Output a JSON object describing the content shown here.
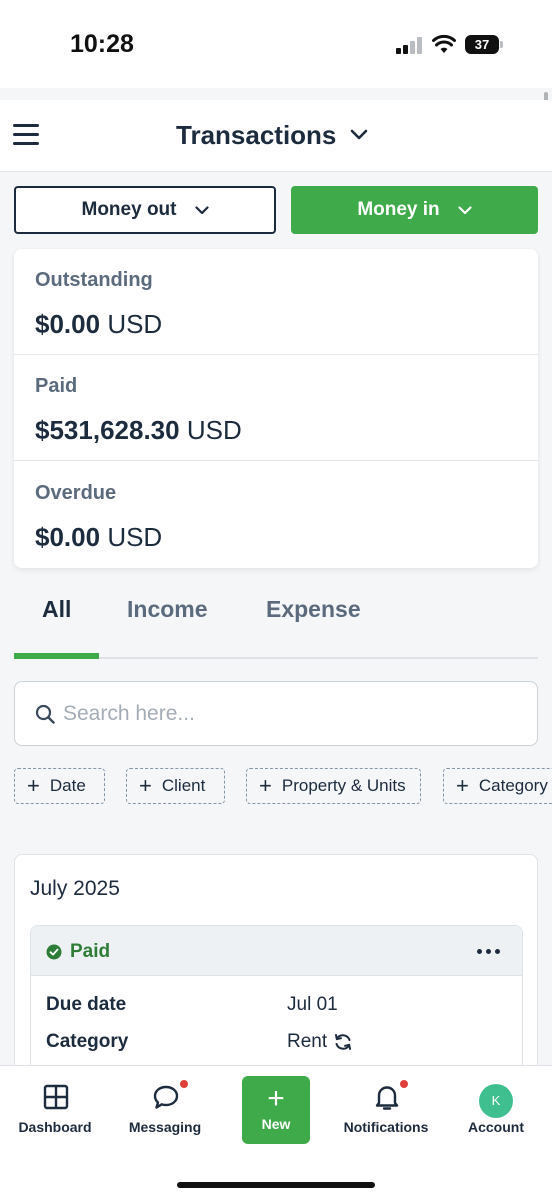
{
  "status_bar": {
    "time": "10:28",
    "battery": "37"
  },
  "header": {
    "title": "Transactions"
  },
  "filters": {
    "money_out": "Money out",
    "money_in": "Money in"
  },
  "summary": [
    {
      "label": "Outstanding",
      "amount": "$0.00",
      "currency": "USD"
    },
    {
      "label": "Paid",
      "amount": "$531,628.30",
      "currency": "USD"
    },
    {
      "label": "Overdue",
      "amount": "$0.00",
      "currency": "USD"
    }
  ],
  "tabs": [
    {
      "label": "All",
      "active": true
    },
    {
      "label": "Income",
      "active": false
    },
    {
      "label": "Expense",
      "active": false
    }
  ],
  "search": {
    "placeholder": "Search here...",
    "value": ""
  },
  "chips": [
    "Date",
    "Client",
    "Property & Units",
    "Category"
  ],
  "transactions": {
    "month": "July 2025",
    "items": [
      {
        "status": "Paid",
        "status_color": "#2e7d36",
        "rows": [
          {
            "label": "Due date",
            "value": "Jul 01"
          },
          {
            "label": "Category",
            "value": "Rent",
            "recurring": true
          }
        ]
      }
    ]
  },
  "bottom_nav": {
    "items": [
      {
        "label": "Dashboard",
        "icon": "grid-icon"
      },
      {
        "label": "Messaging",
        "icon": "chat-bubble-icon",
        "badge": true
      },
      {
        "label": "New",
        "icon": "plus-icon"
      },
      {
        "label": "Notifications",
        "icon": "bell-icon",
        "badge": true
      },
      {
        "label": "Account",
        "icon": "avatar",
        "avatar_initial": "K"
      }
    ]
  },
  "colors": {
    "accent": "#3faa4a",
    "text": "#1c2b3d",
    "muted": "#5b6b7d",
    "badge": "#e0403a",
    "avatar": "#3fbf8f"
  }
}
